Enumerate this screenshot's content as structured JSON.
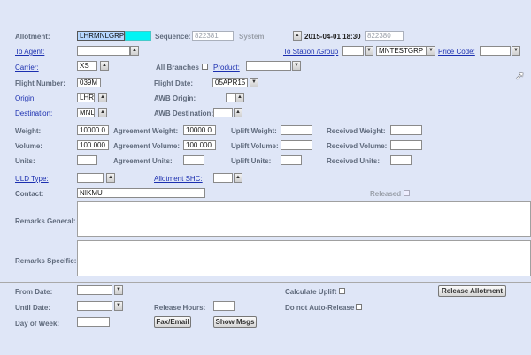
{
  "header": {
    "allotment_label": "Allotment:",
    "allotment_value": "LHRMNLGRP",
    "sequence_label": "Sequence:",
    "sequence_value": "822381",
    "system_label": "System",
    "datetime": "2015-04-01 18:30",
    "system_seq_value": "822380"
  },
  "row_agent": {
    "to_agent_link": "To Agent:",
    "to_agent_value": "",
    "to_station_link": "To Station /Group",
    "station_value": "",
    "group_value": "MNTESTGRP",
    "price_code_link": "Price Code:",
    "price_code_value": ""
  },
  "row_carrier": {
    "carrier_link": "Carrier:",
    "carrier_value": "XS",
    "all_branches_label": "All Branches",
    "product_link": "Product:",
    "product_value": ""
  },
  "row_flight": {
    "flight_number_label": "Flight Number:",
    "flight_number_value": "039M",
    "flight_date_label": "Flight Date:",
    "flight_date_value": "05APR15"
  },
  "row_origin": {
    "origin_link": "Origin:",
    "origin_value": "LHR",
    "awb_origin_label": "AWB Origin:",
    "awb_origin_value": ""
  },
  "row_destination": {
    "destination_link": "Destination:",
    "destination_value": "MNL",
    "awb_destination_label": "AWB Destination:",
    "awb_destination_value": ""
  },
  "measures": {
    "weight_label": "Weight:",
    "weight_value": "10000.0",
    "agreement_weight_label": "Agreement Weight:",
    "agreement_weight_value": "10000.0",
    "uplift_weight_label": "Uplift Weight:",
    "uplift_weight_value": "",
    "received_weight_label": "Received Weight:",
    "received_weight_value": "",
    "volume_label": "Volume:",
    "volume_value": "100.000",
    "agreement_volume_label": "Agreement Volume:",
    "agreement_volume_value": "100.000",
    "uplift_volume_label": "Uplift Volume:",
    "uplift_volume_value": "",
    "received_volume_label": "Received Volume:",
    "received_volume_value": "",
    "units_label": "Units:",
    "units_value": "",
    "agreement_units_label": "Agreement Units:",
    "agreement_units_value": "",
    "uplift_units_label": "Uplift Units:",
    "uplift_units_value": "",
    "received_units_label": "Received Units:",
    "received_units_value": ""
  },
  "row_uld": {
    "uld_type_link": "ULD Type:",
    "uld_type_value": "",
    "allotment_shc_link": "Allotment SHC:",
    "allotment_shc_value": ""
  },
  "row_contact": {
    "contact_label": "Contact:",
    "contact_value": "NIKMU",
    "released_label": "Released"
  },
  "remarks": {
    "general_label": "Remarks General:",
    "specific_label": "Remarks Specific:"
  },
  "footer": {
    "from_date_label": "From Date:",
    "from_date_value": "",
    "calculate_uplift_label": "Calculate Uplift",
    "release_allotment_button": "Release Allotment",
    "until_date_label": "Until Date:",
    "until_date_value": "",
    "release_hours_label": "Release Hours:",
    "release_hours_value": "",
    "auto_release_label": "Do not Auto-Release",
    "day_of_week_label": "Day of Week:",
    "day_of_week_value": "",
    "fax_email_button": "Fax/Email",
    "show_msgs_button": "Show Msgs"
  },
  "icons": {
    "dropdown": "triangle-up",
    "cursor": "mouse-pointer-arrow"
  }
}
